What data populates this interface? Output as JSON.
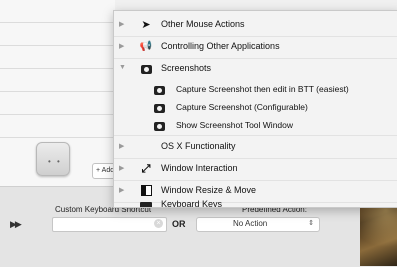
{
  "menu": {
    "items": [
      {
        "label": "Other Mouse Actions",
        "icon": "mouse-pointer-icon",
        "expanded": false
      },
      {
        "label": "Controlling Other Applications",
        "icon": "megaphone-icon",
        "expanded": false
      },
      {
        "label": "Screenshots",
        "icon": "camera-icon",
        "expanded": true,
        "children": [
          {
            "label": "Capture Screenshot then edit in BTT (easiest)",
            "icon": "camera-icon"
          },
          {
            "label": "Capture Screenshot (Configurable)",
            "icon": "camera-icon"
          },
          {
            "label": "Show Screenshot Tool Window",
            "icon": "camera-icon"
          }
        ]
      },
      {
        "label": "OS X Functionality",
        "icon": "apple-icon",
        "expanded": false
      },
      {
        "label": "Window Interaction",
        "icon": "resize-arrows-icon",
        "expanded": false
      },
      {
        "label": "Window Resize & Move",
        "icon": "window-icon",
        "expanded": false
      },
      {
        "label": "Keyboard Keys",
        "icon": "keyboard-icon",
        "expanded": false
      }
    ]
  },
  "glyphs": {
    "disclosure_closed": "▶",
    "disclosure_open": "▼",
    "mouse": "➤",
    "megaphone": "📢",
    "apple": "",
    "resize": "⤢",
    "key_dots": "• •",
    "clear": "×",
    "caret": "⇕",
    "arrows": "▶▶"
  },
  "footer": {
    "add_button": "+ Add",
    "custom_shortcut_label": "Custom Keyboard Shortcut",
    "or_label": "OR",
    "predefined_action_label": "Predefined Action:",
    "action_value": "No Action"
  }
}
